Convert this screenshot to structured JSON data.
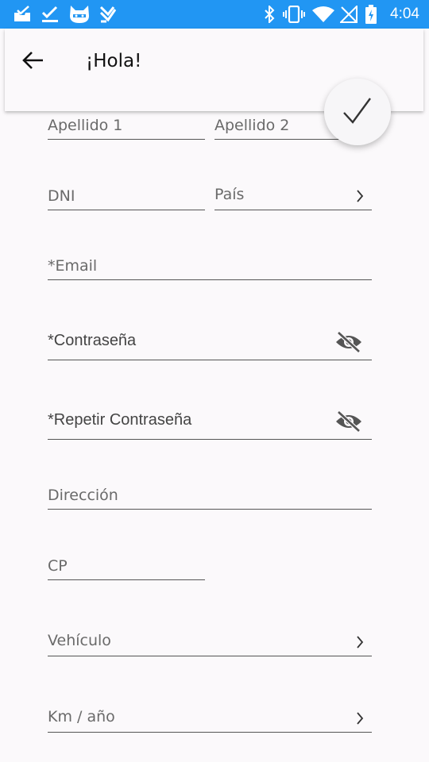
{
  "status_bar": {
    "time": "4:04",
    "color": "#2196f3",
    "left_icons": [
      "inbox-check-icon",
      "check-icon",
      "cyanogen-mod-icon",
      "download-check-icon"
    ],
    "right_icons": [
      "bluetooth-icon",
      "vibrate-icon",
      "wifi-icon",
      "no-signal-icon",
      "battery-charging-icon"
    ]
  },
  "app_bar": {
    "back_icon": "arrow-back-icon",
    "title": "¡Hola!"
  },
  "fab": {
    "icon": "checkmark-icon"
  },
  "form": {
    "apellido1": "Apellido 1",
    "apellido2": "Apellido 2",
    "dni": "DNI",
    "pais": "País",
    "email": "*Email",
    "password": "*Contraseña",
    "repeat_password": "*Repetir Contraseña",
    "direccion": "Dirección",
    "cp": "CP",
    "vehiculo": "Vehículo",
    "km_anio": "Km / año"
  }
}
